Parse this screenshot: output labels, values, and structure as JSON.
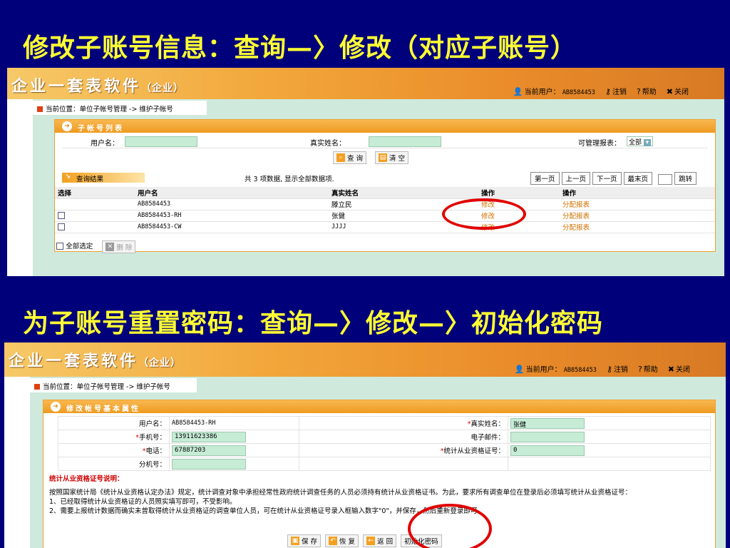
{
  "headings": {
    "first": "修改子账号信息：查询—〉修改（对应子账号）",
    "second": "为子账号重置密码：查询—〉修改—〉初始化密码"
  },
  "app": {
    "brand": "企业一套表软件",
    "brand_sub": "（企业）",
    "current_user_label": "当前用户：",
    "current_user": "AB8584453",
    "logout": "注销",
    "help": "帮助",
    "close": "关闭",
    "breadcrumb": "当前位置：单位子帐号管理 -> 维护子帐号"
  },
  "list_screen": {
    "panel_title": "子帐号列表",
    "username_label": "用户名：",
    "realname_label": "真实姓名：",
    "reports_label": "可管理报表：",
    "reports_value": "全部",
    "query_button": "查 询",
    "clear_button": "清 空",
    "results_label": "查询结果",
    "results_summary": "共 3 项数据, 显示全部数据项.",
    "pager": [
      "第一页",
      "上一页",
      "下一页",
      "最末页"
    ],
    "jump_button": "跳转",
    "columns": [
      "选择",
      "用户名",
      "真实姓名",
      "操作",
      "操作"
    ],
    "rows": [
      {
        "username": "AB8584453",
        "realname": "滕立民",
        "edit": "修改",
        "assign": "分配报表",
        "checkbox": false
      },
      {
        "username": "AB8584453-RH",
        "realname": "张健",
        "edit": "修改",
        "assign": "分配报表",
        "checkbox": true
      },
      {
        "username": "AB8584453-CW",
        "realname": "JJJJ",
        "edit": "修改",
        "assign": "分配报表",
        "checkbox": true
      }
    ],
    "select_all_label": "全部选定",
    "delete_button": "删 除"
  },
  "edit_screen": {
    "panel_title": "修改帐号基本属性",
    "username_label": "用户名：",
    "username_value": "AB8584453-RH",
    "realname_label": "真实姓名：",
    "realname_value": "张健",
    "mobile_label": "手机号：",
    "mobile_value": "13911623386",
    "email_label": "电子邮件：",
    "email_value": "",
    "phone_label": "电话：",
    "phone_value": "67887203",
    "cert_label": "统计从业资格证号：",
    "cert_value": "0",
    "ext_label": "分机号：",
    "ext_value": "",
    "required_mark": "*",
    "note_title": "统计从业资格证号说明：",
    "note_line1": "按照国家统计局《统计从业资格认定办法》规定，统计调查对象中承担经常性政府统计调查任务的人员必须持有统计从业资格证书。为此，要求所有调查单位在登录后必须填写统计从业资格证号：",
    "note_line2": "1、已经取得统计从业资格证的人员照实填写即可，不受影响。",
    "note_line3": "2、需要上报统计数据而确实未曾取得统计从业资格证的调查单位人员，可在统计从业资格证号录入框输入数字\"0\"，并保存，然后重新登录即可。",
    "save_button": "保 存",
    "restore_button": "恢 复",
    "back_button": "返 回",
    "init_password_button": "初始化密码"
  },
  "colors": {
    "slide_bg": "#00007a",
    "heading": "#ffff33",
    "highlight_ring": "#e00000",
    "banner": "#f2a83c"
  }
}
